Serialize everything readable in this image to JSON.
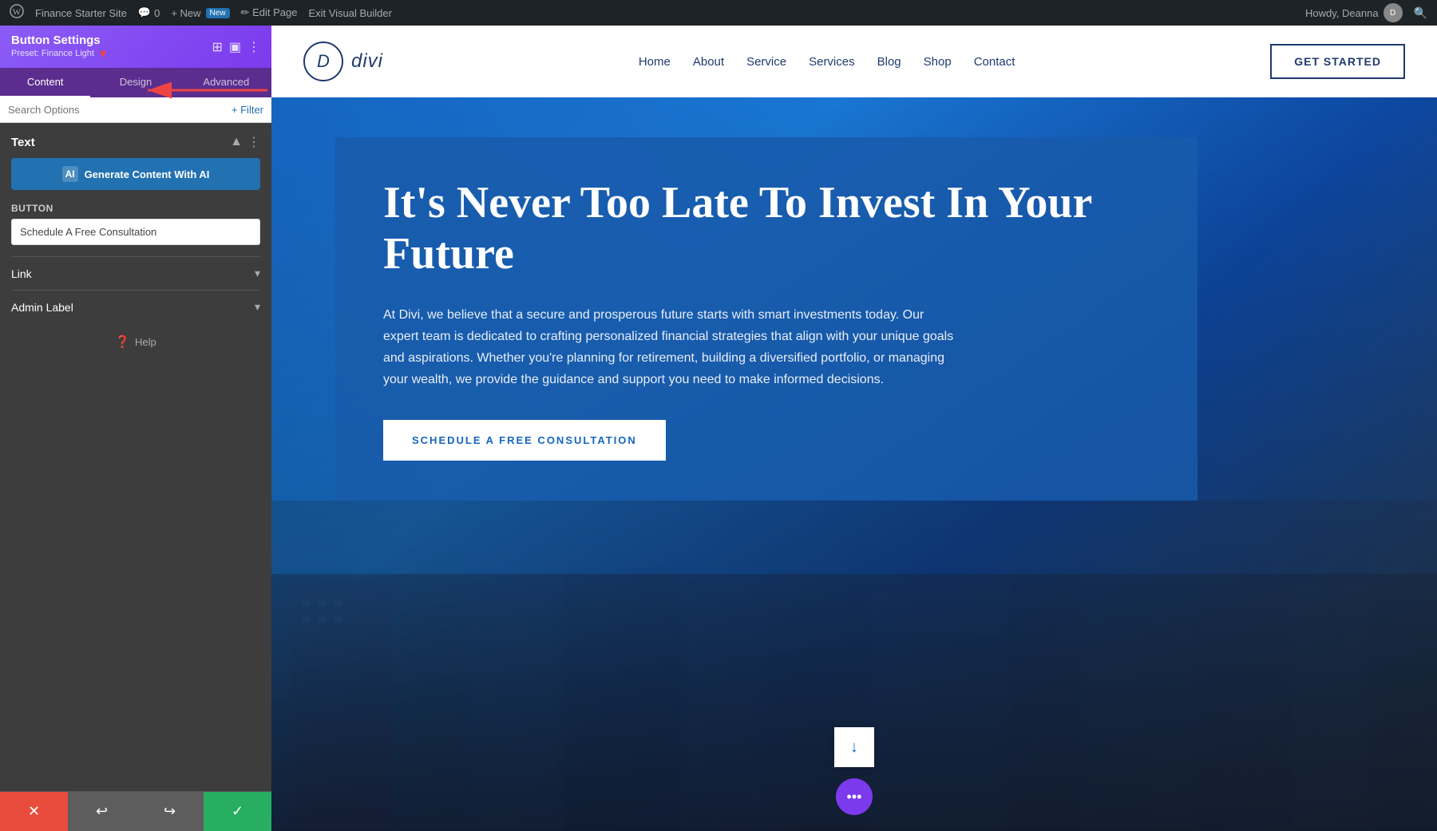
{
  "wp_admin_bar": {
    "wp_icon": "W",
    "site_name": "Finance Starter Site",
    "comments_icon": "💬",
    "comments_count": "0",
    "new_label": "+ New",
    "new_badge": "New",
    "edit_pencil": "✏",
    "edit_page": "Edit Page",
    "exit_vb": "Exit Visual Builder",
    "howdy": "Howdy, Deanna",
    "search_icon": "🔍"
  },
  "sidebar": {
    "title": "Button Settings",
    "preset": "Preset: Finance Light",
    "tabs": [
      "Content",
      "Design",
      "Advanced"
    ],
    "active_tab": "Content",
    "search_placeholder": "Search Options",
    "filter_label": "+ Filter",
    "section_text": {
      "title": "Text",
      "ai_btn": "Generate Content With AI",
      "button_label": "Button",
      "button_value": "Schedule A Free Consultation"
    },
    "link_section": {
      "title": "Link"
    },
    "admin_section": {
      "title": "Admin Label"
    },
    "help_label": "Help"
  },
  "footer_buttons": {
    "cancel": "✕",
    "undo": "↩",
    "redo": "↪",
    "save": "✓"
  },
  "site_header": {
    "logo_letter": "D",
    "logo_name": "divi",
    "nav_items": [
      "Home",
      "About",
      "Service",
      "Services",
      "Blog",
      "Shop",
      "Contact"
    ],
    "cta_btn": "GET STARTED"
  },
  "hero": {
    "title": "It's Never Too Late To Invest In Your Future",
    "description": "At Divi, we believe that a secure and prosperous future starts with smart investments today. Our expert team is dedicated to crafting personalized financial strategies that align with your unique goals and aspirations. Whether you're planning for retirement, building a diversified portfolio, or managing your wealth, we provide the guidance and support you need to make informed decisions.",
    "cta_btn": "SCHEDULE A FREE CONSULTATION",
    "scroll_down_arrow": "↓",
    "purple_dots": "•••"
  }
}
